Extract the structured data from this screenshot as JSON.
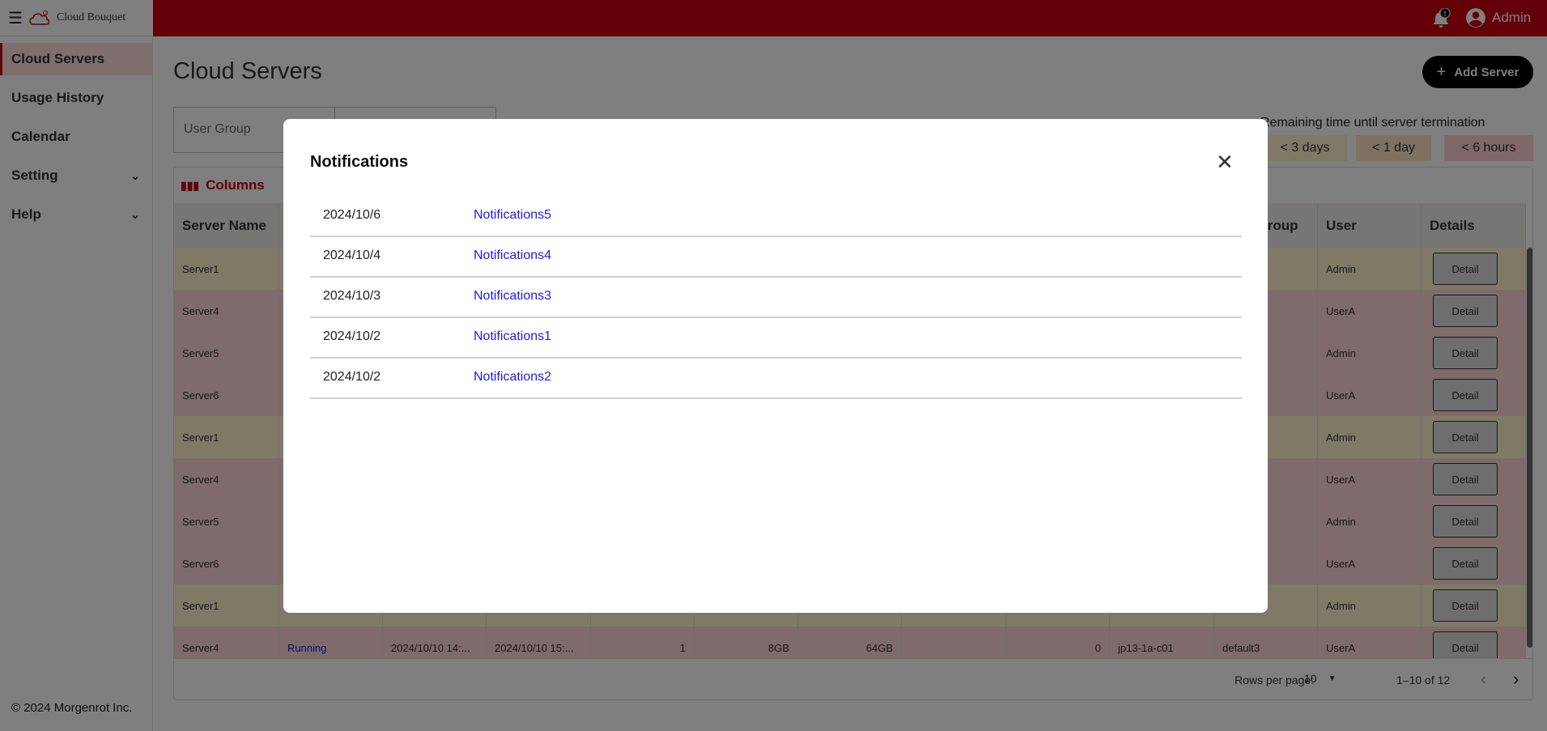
{
  "app": {
    "name": "Cloud Bouquet",
    "user": "Admin",
    "brand_color": "#c8000f"
  },
  "sidebar": {
    "items": [
      {
        "label": "Cloud Servers",
        "active": true
      },
      {
        "label": "Usage History"
      },
      {
        "label": "Calendar"
      },
      {
        "label": "Setting",
        "expandable": true
      },
      {
        "label": "Help",
        "expandable": true
      }
    ],
    "copyright": "© 2024 Morgenrot Inc."
  },
  "main": {
    "title": "Cloud Servers",
    "add_button": "Add Server",
    "filters": {
      "user_group_placeholder": "User Group",
      "second": ""
    },
    "legend": {
      "label": "Remaining time until server termination",
      "chips": [
        {
          "label": "< 3 days",
          "color": "#fff5cc"
        },
        {
          "label": "< 1 day",
          "color": "#ffe2c0"
        },
        {
          "label": "< 6 hours",
          "color": "#ffd0d4"
        }
      ]
    },
    "toolbar": {
      "columns": "Columns"
    },
    "table": {
      "headers": [
        "Server Name",
        "",
        "",
        "",
        "",
        "",
        "",
        "",
        "",
        "",
        "User Group",
        "User",
        "Details"
      ],
      "rows": [
        {
          "name": "Server1",
          "tone": "yellow",
          "cells": [
            "",
            "",
            "",
            "",
            "",
            "",
            "",
            "",
            "",
            ""
          ],
          "user": "Admin",
          "detail": "Detail"
        },
        {
          "name": "Server4",
          "tone": "pink",
          "cells": [
            "",
            "",
            "",
            "",
            "",
            "",
            "",
            "",
            "",
            ""
          ],
          "user": "UserA",
          "detail": "Detail"
        },
        {
          "name": "Server5",
          "tone": "pink",
          "cells": [
            "",
            "",
            "",
            "",
            "",
            "",
            "",
            "",
            "",
            ""
          ],
          "user": "Admin",
          "detail": "Detail"
        },
        {
          "name": "Server6",
          "tone": "pink",
          "cells": [
            "",
            "",
            "",
            "",
            "",
            "",
            "",
            "",
            "",
            ""
          ],
          "user": "UserA",
          "detail": "Detail"
        },
        {
          "name": "Server1",
          "tone": "yellow",
          "cells": [
            "",
            "",
            "",
            "",
            "",
            "",
            "",
            "",
            "",
            ""
          ],
          "user": "Admin",
          "detail": "Detail"
        },
        {
          "name": "Server4",
          "tone": "pink",
          "cells": [
            "",
            "",
            "",
            "",
            "",
            "",
            "",
            "",
            "",
            ""
          ],
          "user": "UserA",
          "detail": "Detail"
        },
        {
          "name": "Server5",
          "tone": "pink",
          "cells": [
            "",
            "",
            "",
            "",
            "",
            "",
            "",
            "",
            "",
            ""
          ],
          "user": "Admin",
          "detail": "Detail"
        },
        {
          "name": "Server6",
          "tone": "pink",
          "cells": [
            "",
            "",
            "",
            "",
            "",
            "",
            "",
            "",
            "",
            ""
          ],
          "user": "UserA",
          "detail": "Detail"
        },
        {
          "name": "Server1",
          "tone": "yellow",
          "cells": [
            "",
            "",
            "",
            "",
            "",
            "",
            "",
            "",
            "",
            ""
          ],
          "user": "Admin",
          "detail": "Detail"
        },
        {
          "name": "Server4",
          "tone": "pink",
          "cells": [
            "Running",
            "2024/10/10 14:...",
            "2024/10/10 15:...",
            "1",
            "8GB",
            "64GB",
            "",
            "0",
            "jp13-1a-c01",
            "default3"
          ],
          "user": "UserA",
          "detail": "Detail"
        }
      ]
    },
    "pagination": {
      "rows_per_page_label": "Rows per page:",
      "rows_per_page": "10",
      "range": "1–10 of 12"
    }
  },
  "modal": {
    "title": "Notifications",
    "items": [
      {
        "date": "2024/10/6",
        "link": "Notifications5"
      },
      {
        "date": "2024/10/4",
        "link": "Notifications4"
      },
      {
        "date": "2024/10/3",
        "link": "Notifications3"
      },
      {
        "date": "2024/10/2",
        "link": "Notifications1"
      },
      {
        "date": "2024/10/2",
        "link": "Notifications2"
      }
    ]
  }
}
